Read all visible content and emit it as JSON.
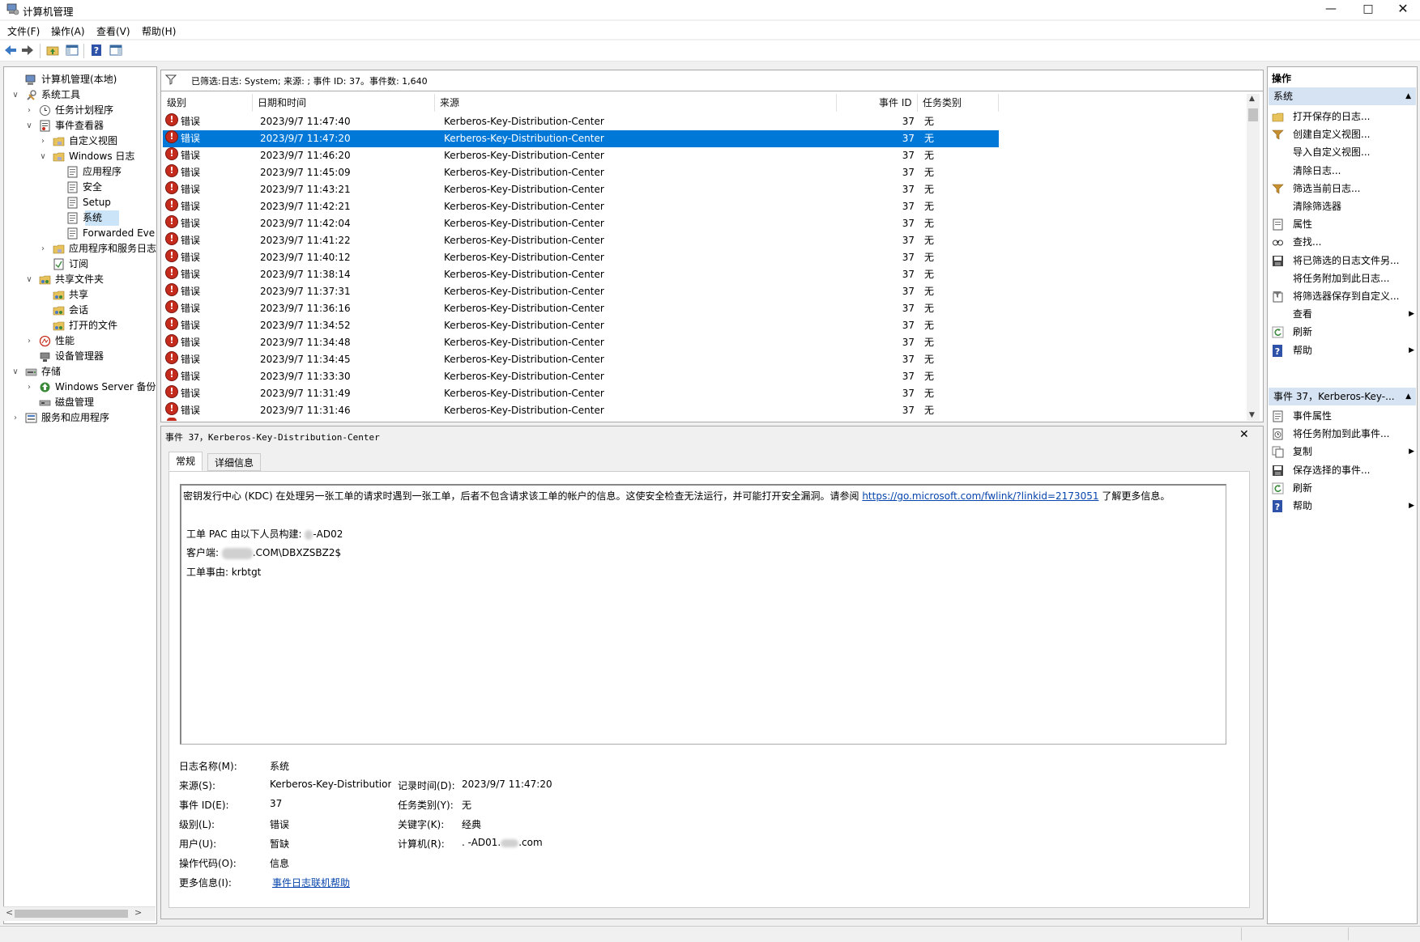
{
  "window": {
    "title": "计算机管理"
  },
  "menu": [
    "文件(F)",
    "操作(A)",
    "查看(V)",
    "帮助(H)"
  ],
  "tree": [
    {
      "label": "计算机管理(本地)",
      "level": 0,
      "arrow": "",
      "icon": "computer-icon"
    },
    {
      "label": "系统工具",
      "level": 0,
      "arrow": "v",
      "icon": "tools-icon"
    },
    {
      "label": "任务计划程序",
      "level": 1,
      "arrow": ">",
      "icon": "clock-icon"
    },
    {
      "label": "事件查看器",
      "level": 1,
      "arrow": "v",
      "icon": "event-viewer-icon"
    },
    {
      "label": "自定义视图",
      "level": 2,
      "arrow": ">",
      "icon": "folder-icon"
    },
    {
      "label": "Windows 日志",
      "level": 2,
      "arrow": "v",
      "icon": "folder-icon"
    },
    {
      "label": "应用程序",
      "level": 3,
      "arrow": "",
      "icon": "log-icon"
    },
    {
      "label": "安全",
      "level": 3,
      "arrow": "",
      "icon": "log-icon"
    },
    {
      "label": "Setup",
      "level": 3,
      "arrow": "",
      "icon": "log-icon"
    },
    {
      "label": "系统",
      "level": 3,
      "arrow": "",
      "icon": "log-icon"
    },
    {
      "label": "Forwarded Eve",
      "level": 3,
      "arrow": "",
      "icon": "log-icon"
    },
    {
      "label": "应用程序和服务日志",
      "level": 2,
      "arrow": ">",
      "icon": "folder-icon"
    },
    {
      "label": "订阅",
      "level": 2,
      "arrow": "",
      "icon": "subscription-icon"
    },
    {
      "label": "共享文件夹",
      "level": 1,
      "arrow": "v",
      "icon": "shared-folder-icon"
    },
    {
      "label": "共享",
      "level": 2,
      "arrow": "",
      "icon": "shared-folder-icon"
    },
    {
      "label": "会话",
      "level": 2,
      "arrow": "",
      "icon": "shared-folder-icon"
    },
    {
      "label": "打开的文件",
      "level": 2,
      "arrow": "",
      "icon": "shared-folder-icon"
    },
    {
      "label": "性能",
      "level": 1,
      "arrow": ">",
      "icon": "performance-icon"
    },
    {
      "label": "设备管理器",
      "level": 1,
      "arrow": "",
      "icon": "device-manager-icon"
    },
    {
      "label": "存储",
      "level": 0,
      "arrow": "v",
      "icon": "storage-icon"
    },
    {
      "label": "Windows Server 备份",
      "level": 1,
      "arrow": ">",
      "icon": "backup-icon"
    },
    {
      "label": "磁盘管理",
      "level": 1,
      "arrow": "",
      "icon": "disk-icon"
    },
    {
      "label": "服务和应用程序",
      "level": 0,
      "arrow": ">",
      "icon": "services-icon"
    }
  ],
  "filter": {
    "text": "已筛选:日志: System; 来源: ; 事件 ID: 37。事件数: 1,640"
  },
  "table": {
    "headers": [
      "级别",
      "日期和时间",
      "来源",
      "事件 ID",
      "任务类别"
    ],
    "rows": [
      {
        "level": "错误",
        "time": "2023/9/7 11:47:40",
        "source": "Kerberos-Key-Distribution-Center",
        "id": "37",
        "cat": "无"
      },
      {
        "level": "错误",
        "time": "2023/9/7 11:47:20",
        "source": "Kerberos-Key-Distribution-Center",
        "id": "37",
        "cat": "无"
      },
      {
        "level": "错误",
        "time": "2023/9/7 11:46:20",
        "source": "Kerberos-Key-Distribution-Center",
        "id": "37",
        "cat": "无"
      },
      {
        "level": "错误",
        "time": "2023/9/7 11:45:09",
        "source": "Kerberos-Key-Distribution-Center",
        "id": "37",
        "cat": "无"
      },
      {
        "level": "错误",
        "time": "2023/9/7 11:43:21",
        "source": "Kerberos-Key-Distribution-Center",
        "id": "37",
        "cat": "无"
      },
      {
        "level": "错误",
        "time": "2023/9/7 11:42:21",
        "source": "Kerberos-Key-Distribution-Center",
        "id": "37",
        "cat": "无"
      },
      {
        "level": "错误",
        "time": "2023/9/7 11:42:04",
        "source": "Kerberos-Key-Distribution-Center",
        "id": "37",
        "cat": "无"
      },
      {
        "level": "错误",
        "time": "2023/9/7 11:41:22",
        "source": "Kerberos-Key-Distribution-Center",
        "id": "37",
        "cat": "无"
      },
      {
        "level": "错误",
        "time": "2023/9/7 11:40:12",
        "source": "Kerberos-Key-Distribution-Center",
        "id": "37",
        "cat": "无"
      },
      {
        "level": "错误",
        "time": "2023/9/7 11:38:14",
        "source": "Kerberos-Key-Distribution-Center",
        "id": "37",
        "cat": "无"
      },
      {
        "level": "错误",
        "time": "2023/9/7 11:37:31",
        "source": "Kerberos-Key-Distribution-Center",
        "id": "37",
        "cat": "无"
      },
      {
        "level": "错误",
        "time": "2023/9/7 11:36:16",
        "source": "Kerberos-Key-Distribution-Center",
        "id": "37",
        "cat": "无"
      },
      {
        "level": "错误",
        "time": "2023/9/7 11:34:52",
        "source": "Kerberos-Key-Distribution-Center",
        "id": "37",
        "cat": "无"
      },
      {
        "level": "错误",
        "time": "2023/9/7 11:34:48",
        "source": "Kerberos-Key-Distribution-Center",
        "id": "37",
        "cat": "无"
      },
      {
        "level": "错误",
        "time": "2023/9/7 11:34:45",
        "source": "Kerberos-Key-Distribution-Center",
        "id": "37",
        "cat": "无"
      },
      {
        "level": "错误",
        "time": "2023/9/7 11:33:30",
        "source": "Kerberos-Key-Distribution-Center",
        "id": "37",
        "cat": "无"
      },
      {
        "level": "错误",
        "time": "2023/9/7 11:31:49",
        "source": "Kerberos-Key-Distribution-Center",
        "id": "37",
        "cat": "无"
      },
      {
        "level": "错误",
        "time": "2023/9/7 11:31:46",
        "source": "Kerberos-Key-Distribution-Center",
        "id": "37",
        "cat": "无"
      }
    ]
  },
  "detail": {
    "title": "事件 37，Kerberos-Key-Distribution-Center",
    "tabs": [
      "常规",
      "详细信息"
    ],
    "desc_main": "密钥发行中心 (KDC) 在处理另一张工单的请求时遇到一张工单，后者不包含请求该工单的帐户的信息。这使安全检查无法运行，并可能打开安全漏洞。请参阅",
    "desc_link": "https://go.microsoft.com/fwlink/?linkid=2173051",
    "desc_tail": "了解更多信息。",
    "pac_label": "工单 PAC 由以下人员构建: ",
    "pac_value": "-AD02",
    "client_label": "客户端: ",
    "client_value": ".COM\\DBXZSBZ2$",
    "reason": "工单事由: krbtgt",
    "fields": {
      "log_name_label": "日志名称(M):",
      "log_name": "系统",
      "source_label": "来源(S):",
      "source": "Kerberos-Key-Distributior",
      "recorded_label": "记录时间(D):",
      "recorded": "2023/9/7 11:47:20",
      "event_id_label": "事件 ID(E):",
      "event_id": "37",
      "task_label": "任务类别(Y):",
      "task": "无",
      "level_label": "级别(L):",
      "level": "错误",
      "keywords_label": "关键字(K):",
      "keywords": "经典",
      "user_label": "用户(U):",
      "user": "暂缺",
      "computer_label": "计算机(R):",
      "computer_a": ". -AD01.",
      "computer_b": ".com",
      "opcode_label": "操作代码(O):",
      "opcode": "信息",
      "more_label": "更多信息(I):",
      "more_link": "事件日志联机帮助"
    }
  },
  "actions": {
    "header": "操作",
    "section1": "系统",
    "items1": [
      {
        "label": "打开保存的日志...",
        "icon": "open-log-icon",
        "sub": ""
      },
      {
        "label": "创建自定义视图...",
        "icon": "filter-icon",
        "sub": ""
      },
      {
        "label": "导入自定义视图...",
        "icon": "",
        "sub": ""
      },
      {
        "label": "清除日志...",
        "icon": "",
        "sub": ""
      },
      {
        "label": "筛选当前日志...",
        "icon": "filter-icon",
        "sub": ""
      },
      {
        "label": "清除筛选器",
        "icon": "",
        "sub": ""
      },
      {
        "label": "属性",
        "icon": "properties-icon",
        "sub": ""
      },
      {
        "label": "查找...",
        "icon": "find-icon",
        "sub": ""
      },
      {
        "label": "将已筛选的日志文件另...",
        "icon": "save-icon",
        "sub": ""
      },
      {
        "label": "将任务附加到此日志...",
        "icon": "",
        "sub": ""
      },
      {
        "label": "将筛选器保存到自定义...",
        "icon": "save-filter-icon",
        "sub": ""
      },
      {
        "label": "查看",
        "icon": "",
        "sub": "▶"
      },
      {
        "label": "刷新",
        "icon": "refresh-icon",
        "sub": ""
      },
      {
        "label": "帮助",
        "icon": "help-icon",
        "sub": "▶"
      }
    ],
    "section2": "事件 37，Kerberos-Key-...",
    "items2": [
      {
        "label": "事件属性",
        "icon": "event-properties-icon",
        "sub": ""
      },
      {
        "label": "将任务附加到此事件...",
        "icon": "attach-task-icon",
        "sub": ""
      },
      {
        "label": "复制",
        "icon": "copy-icon",
        "sub": "▶"
      },
      {
        "label": "保存选择的事件...",
        "icon": "save-icon",
        "sub": ""
      },
      {
        "label": "刷新",
        "icon": "refresh-icon",
        "sub": ""
      },
      {
        "label": "帮助",
        "icon": "help-icon",
        "sub": "▶"
      }
    ]
  },
  "colors": {
    "selection": "#0078d7",
    "error": "#c42b1c",
    "section_header": "#d6e3f3",
    "link": "#0645ad"
  }
}
